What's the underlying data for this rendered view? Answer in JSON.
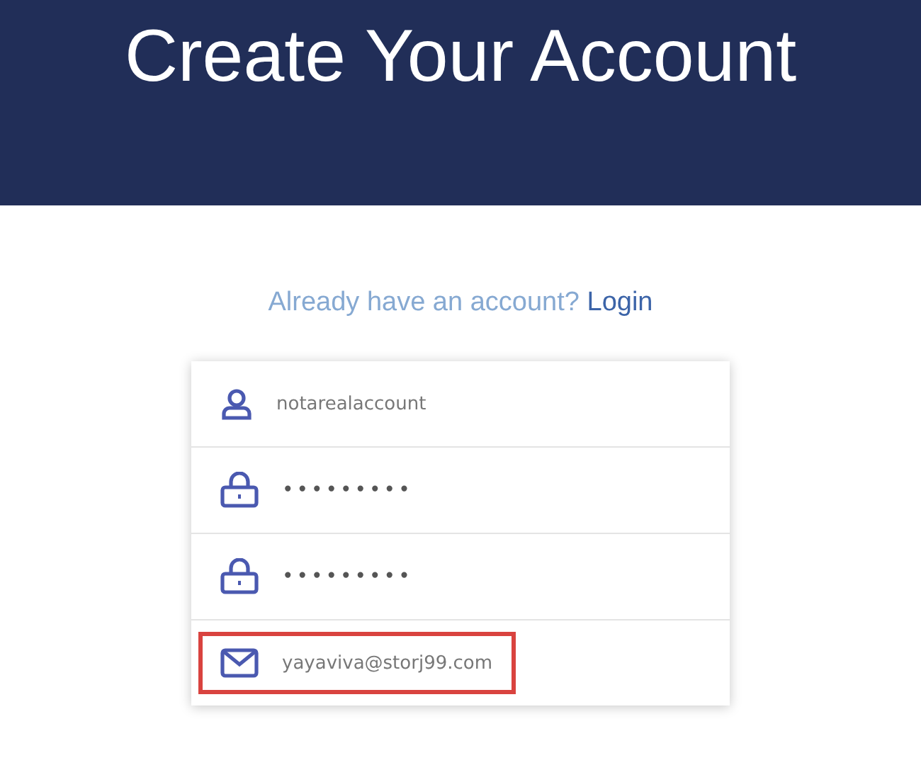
{
  "header": {
    "title": "Create Your Account"
  },
  "login_prompt": {
    "text": "Already have an account?",
    "link": "Login"
  },
  "fields": [
    {
      "kind": "user",
      "value": "notarealaccount",
      "highlighted": false
    },
    {
      "kind": "lock",
      "value": "•••••••••",
      "highlighted": false
    },
    {
      "kind": "lock",
      "value": "•••••••••",
      "highlighted": false
    },
    {
      "kind": "mail",
      "value": "yayaviva@storj99.com",
      "highlighted": true
    }
  ]
}
